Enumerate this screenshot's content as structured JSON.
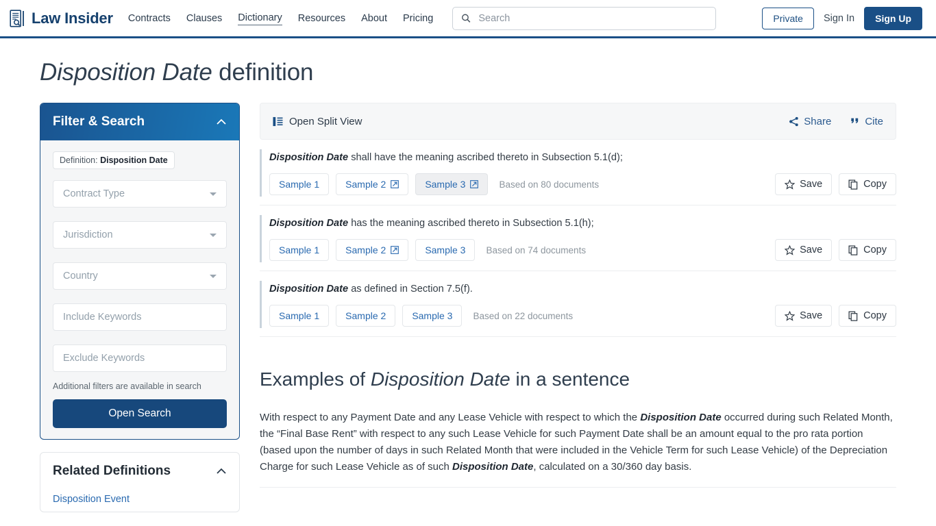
{
  "header": {
    "logo_text": "Law Insider",
    "logo_icon": "document-search-icon",
    "nav": [
      {
        "label": "Contracts",
        "active": false
      },
      {
        "label": "Clauses",
        "active": false
      },
      {
        "label": "Dictionary",
        "active": true
      },
      {
        "label": "Resources",
        "active": false
      },
      {
        "label": "About",
        "active": false
      },
      {
        "label": "Pricing",
        "active": false
      }
    ],
    "search": {
      "placeholder": "Search",
      "value": "",
      "icon": "search-icon"
    },
    "private_label": "Private",
    "signin_label": "Sign In",
    "signup_label": "Sign Up"
  },
  "page": {
    "title_term": "Disposition Date",
    "title_suffix": " definition"
  },
  "sidebar": {
    "filter": {
      "title": "Filter & Search",
      "collapse_icon": "chevron-up-icon",
      "chip_prefix": "Definition: ",
      "chip_term": "Disposition Date",
      "selects": [
        {
          "label": "Contract Type"
        },
        {
          "label": "Jurisdiction"
        },
        {
          "label": "Country"
        }
      ],
      "inputs": [
        {
          "placeholder": "Include Keywords",
          "value": ""
        },
        {
          "placeholder": "Exclude Keywords",
          "value": ""
        }
      ],
      "note": "Additional filters are available in search",
      "open_search_label": "Open Search"
    },
    "related": {
      "title": "Related Definitions",
      "collapse_icon": "chevron-up-icon",
      "items": [
        "Disposition Event"
      ]
    }
  },
  "toolbar": {
    "split_view_label": "Open Split View",
    "split_view_icon": "split-view-icon",
    "share_label": "Share",
    "share_icon": "share-icon",
    "cite_label": "Cite",
    "cite_icon": "quote-icon"
  },
  "definitions": [
    {
      "term": "Disposition Date",
      "text": " shall have the meaning ascribed thereto in Subsection 5.1(d);",
      "samples": [
        {
          "label": "Sample 1",
          "external": false,
          "highlighted": false
        },
        {
          "label": "Sample 2",
          "external": true,
          "highlighted": false
        },
        {
          "label": "Sample 3",
          "external": true,
          "highlighted": true
        }
      ],
      "based_on": "Based on 80 documents",
      "save_label": "Save",
      "copy_label": "Copy"
    },
    {
      "term": "Disposition Date",
      "text": " has the meaning ascribed thereto in Subsection 5.1(h);",
      "samples": [
        {
          "label": "Sample 1",
          "external": false,
          "highlighted": false
        },
        {
          "label": "Sample 2",
          "external": true,
          "highlighted": false
        },
        {
          "label": "Sample 3",
          "external": false,
          "highlighted": false
        }
      ],
      "based_on": "Based on 74 documents",
      "save_label": "Save",
      "copy_label": "Copy"
    },
    {
      "term": "Disposition Date",
      "text": " as defined in Section 7.5(f).",
      "samples": [
        {
          "label": "Sample 1",
          "external": false,
          "highlighted": false
        },
        {
          "label": "Sample 2",
          "external": false,
          "highlighted": false
        },
        {
          "label": "Sample 3",
          "external": false,
          "highlighted": false
        }
      ],
      "based_on": "Based on 22 documents",
      "save_label": "Save",
      "copy_label": "Copy"
    }
  ],
  "examples": {
    "heading_prefix": "Examples of ",
    "heading_term": "Disposition Date",
    "heading_suffix": " in a sentence",
    "paragraph": {
      "part1": "With respect to any Payment Date and any Lease Vehicle with respect to which the ",
      "bold1": "Disposition Date",
      "part2": " occurred during such Related Month, the “Final Base Rent” with respect to any such Lease Vehicle for such Payment Date shall be an amount equal to the pro rata portion (based upon the number of days in such Related Month that were included in the Vehicle Term for such Lease Vehicle) of the Depreciation Charge for such Lease Vehicle as of such ",
      "bold2": "Disposition Date",
      "part3": ", calculated on a 30/360 day basis."
    }
  },
  "colors": {
    "brand_blue": "#1a4f86",
    "link_blue": "#2a6ab0",
    "header_gradient_start": "#1a5490",
    "header_gradient_end": "#1a78b8",
    "open_search_blue": "#17487c"
  }
}
